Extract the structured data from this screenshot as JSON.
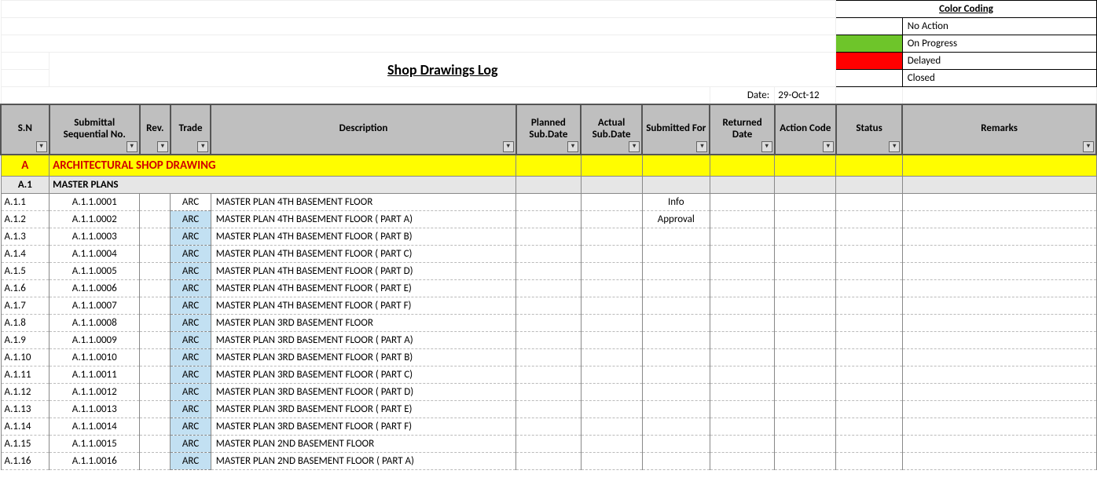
{
  "title": "Shop Drawings Log",
  "date_label": "Date:",
  "date_value": "29-Oct-12",
  "legend": {
    "title": "Color Coding",
    "items": [
      {
        "label": "No Action",
        "swatch_class": "sw-noaction"
      },
      {
        "label": "On Progress",
        "swatch_class": "sw-progress"
      },
      {
        "label": "Delayed",
        "swatch_class": "sw-delayed"
      },
      {
        "label": "Closed",
        "swatch_class": "sw-closed"
      }
    ]
  },
  "headers": {
    "sn": "S.N",
    "seq": "Submittal Sequential No.",
    "rev": "Rev.",
    "trade": "Trade",
    "desc": "Description",
    "planned": "Planned Sub.Date",
    "actual": "Actual Sub.Date",
    "subfor": "Submitted For",
    "returned": "Returned Date",
    "action": "Action Code",
    "status": "Status",
    "remarks": "Remarks"
  },
  "category": {
    "sn": "A",
    "label": "ARCHITECTURAL SHOP DRAWING"
  },
  "subcategory": {
    "sn": "A.1",
    "label": "MASTER PLANS"
  },
  "rows": [
    {
      "sn": "A.1.1",
      "seq": "A.1.1.0001",
      "trade": "ARC",
      "trade_plain": true,
      "desc": "MASTER PLAN  4TH BASEMENT FLOOR",
      "subfor": "Info"
    },
    {
      "sn": "A.1.2",
      "seq": "A.1.1.0002",
      "trade": "ARC",
      "desc": "MASTER PLAN  4TH BASEMENT FLOOR ( PART A)",
      "subfor": "Approval"
    },
    {
      "sn": "A.1.3",
      "seq": "A.1.1.0003",
      "trade": "ARC",
      "desc": "MASTER PLAN  4TH BASEMENT FLOOR ( PART B)"
    },
    {
      "sn": "A.1.4",
      "seq": "A.1.1.0004",
      "trade": "ARC",
      "desc": "MASTER PLAN  4TH BASEMENT FLOOR ( PART C)"
    },
    {
      "sn": "A.1.5",
      "seq": "A.1.1.0005",
      "trade": "ARC",
      "desc": "MASTER PLAN  4TH BASEMENT FLOOR ( PART D)"
    },
    {
      "sn": "A.1.6",
      "seq": "A.1.1.0006",
      "trade": "ARC",
      "desc": "MASTER PLAN  4TH BASEMENT FLOOR ( PART E)"
    },
    {
      "sn": "A.1.7",
      "seq": "A.1.1.0007",
      "trade": "ARC",
      "desc": "MASTER PLAN  4TH BASEMENT FLOOR ( PART F)"
    },
    {
      "sn": "A.1.8",
      "seq": "A.1.1.0008",
      "trade": "ARC",
      "desc": "MASTER PLAN  3RD BASEMENT FLOOR"
    },
    {
      "sn": "A.1.9",
      "seq": "A.1.1.0009",
      "trade": "ARC",
      "desc": "MASTER PLAN  3RD BASEMENT FLOOR ( PART A)"
    },
    {
      "sn": "A.1.10",
      "seq": "A.1.1.0010",
      "trade": "ARC",
      "desc": "MASTER PLAN  3RD BASEMENT FLOOR ( PART B)"
    },
    {
      "sn": "A.1.11",
      "seq": "A.1.1.0011",
      "trade": "ARC",
      "desc": "MASTER PLAN  3RD BASEMENT FLOOR ( PART C)"
    },
    {
      "sn": "A.1.12",
      "seq": "A.1.1.0012",
      "trade": "ARC",
      "desc": "MASTER PLAN  3RD BASEMENT FLOOR ( PART D)"
    },
    {
      "sn": "A.1.13",
      "seq": "A.1.1.0013",
      "trade": "ARC",
      "desc": "MASTER PLAN  3RD BASEMENT FLOOR ( PART E)"
    },
    {
      "sn": "A.1.14",
      "seq": "A.1.1.0014",
      "trade": "ARC",
      "desc": "MASTER PLAN  3RD BASEMENT FLOOR ( PART F)"
    },
    {
      "sn": "A.1.15",
      "seq": "A.1.1.0015",
      "trade": "ARC",
      "desc": "MASTER PLAN  2ND BASEMENT FLOOR"
    },
    {
      "sn": "A.1.16",
      "seq": "A.1.1.0016",
      "trade": "ARC",
      "desc": "MASTER PLAN  2ND BASEMENT FLOOR ( PART A)"
    }
  ]
}
